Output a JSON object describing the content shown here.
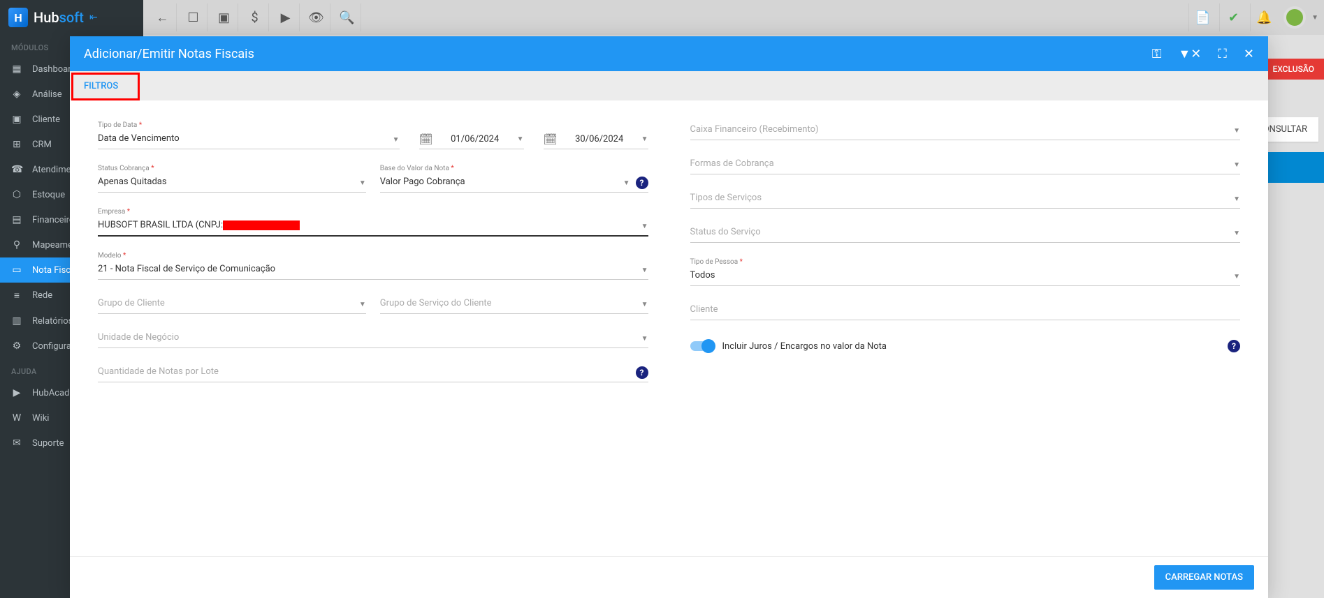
{
  "brand": {
    "hub": "Hub",
    "soft": "soft"
  },
  "sidebar": {
    "section_modulos": "MÓDULOS",
    "section_ajuda": "AJUDA",
    "items": [
      {
        "label": "Dashboard",
        "icon": "▦"
      },
      {
        "label": "Análise",
        "icon": "◈"
      },
      {
        "label": "Cliente",
        "icon": "▣"
      },
      {
        "label": "CRM",
        "icon": "⊞"
      },
      {
        "label": "Atendimento",
        "icon": "☎"
      },
      {
        "label": "Estoque",
        "icon": "⬡"
      },
      {
        "label": "Financeiro",
        "icon": "▤"
      },
      {
        "label": "Mapeamento",
        "icon": "⚲"
      },
      {
        "label": "Nota Fiscal",
        "icon": "▭"
      },
      {
        "label": "Rede",
        "icon": "≡"
      },
      {
        "label": "Relatórios",
        "icon": "▥"
      },
      {
        "label": "Configurações",
        "icon": "⚙"
      }
    ],
    "help_items": [
      {
        "label": "HubAcademy",
        "icon": "▶"
      },
      {
        "label": "Wiki",
        "icon": "W"
      },
      {
        "label": "Suporte",
        "icon": "✉"
      }
    ]
  },
  "bg": {
    "exclusao": "EXCLUSÃO",
    "consultar": "CONSULTAR"
  },
  "modal": {
    "title": "Adicionar/Emitir Notas Fiscais",
    "tab_filtros": "FILTROS",
    "footer_btn": "CARREGAR NOTAS"
  },
  "filters": {
    "tipo_data_label": "Tipo de Data",
    "tipo_data_value": "Data de Vencimento",
    "data_inicio": "01/06/2024",
    "data_fim": "30/06/2024",
    "status_cobranca_label": "Status Cobrança",
    "status_cobranca_value": "Apenas Quitadas",
    "base_valor_label": "Base do Valor da Nota",
    "base_valor_value": "Valor Pago Cobrança",
    "empresa_label": "Empresa",
    "empresa_value_prefix": "HUBSOFT BRASIL LTDA (CNPJ:",
    "modelo_label": "Modelo",
    "modelo_value": "21 - Nota Fiscal de Serviço de Comunicação",
    "grupo_cliente_placeholder": "Grupo de Cliente",
    "grupo_servico_placeholder": "Grupo de Serviço do Cliente",
    "unidade_negocio_placeholder": "Unidade de Negócio",
    "qtd_notas_placeholder": "Quantidade de Notas por Lote",
    "caixa_financeiro_placeholder": "Caixa Financeiro (Recebimento)",
    "formas_cobranca_placeholder": "Formas de Cobrança",
    "tipos_servicos_placeholder": "Tipos de Serviços",
    "status_servico_placeholder": "Status do Serviço",
    "tipo_pessoa_label": "Tipo de Pessoa",
    "tipo_pessoa_value": "Todos",
    "cliente_placeholder": "Cliente",
    "incluir_juros_label": "Incluir Juros / Encargos no valor da Nota"
  }
}
